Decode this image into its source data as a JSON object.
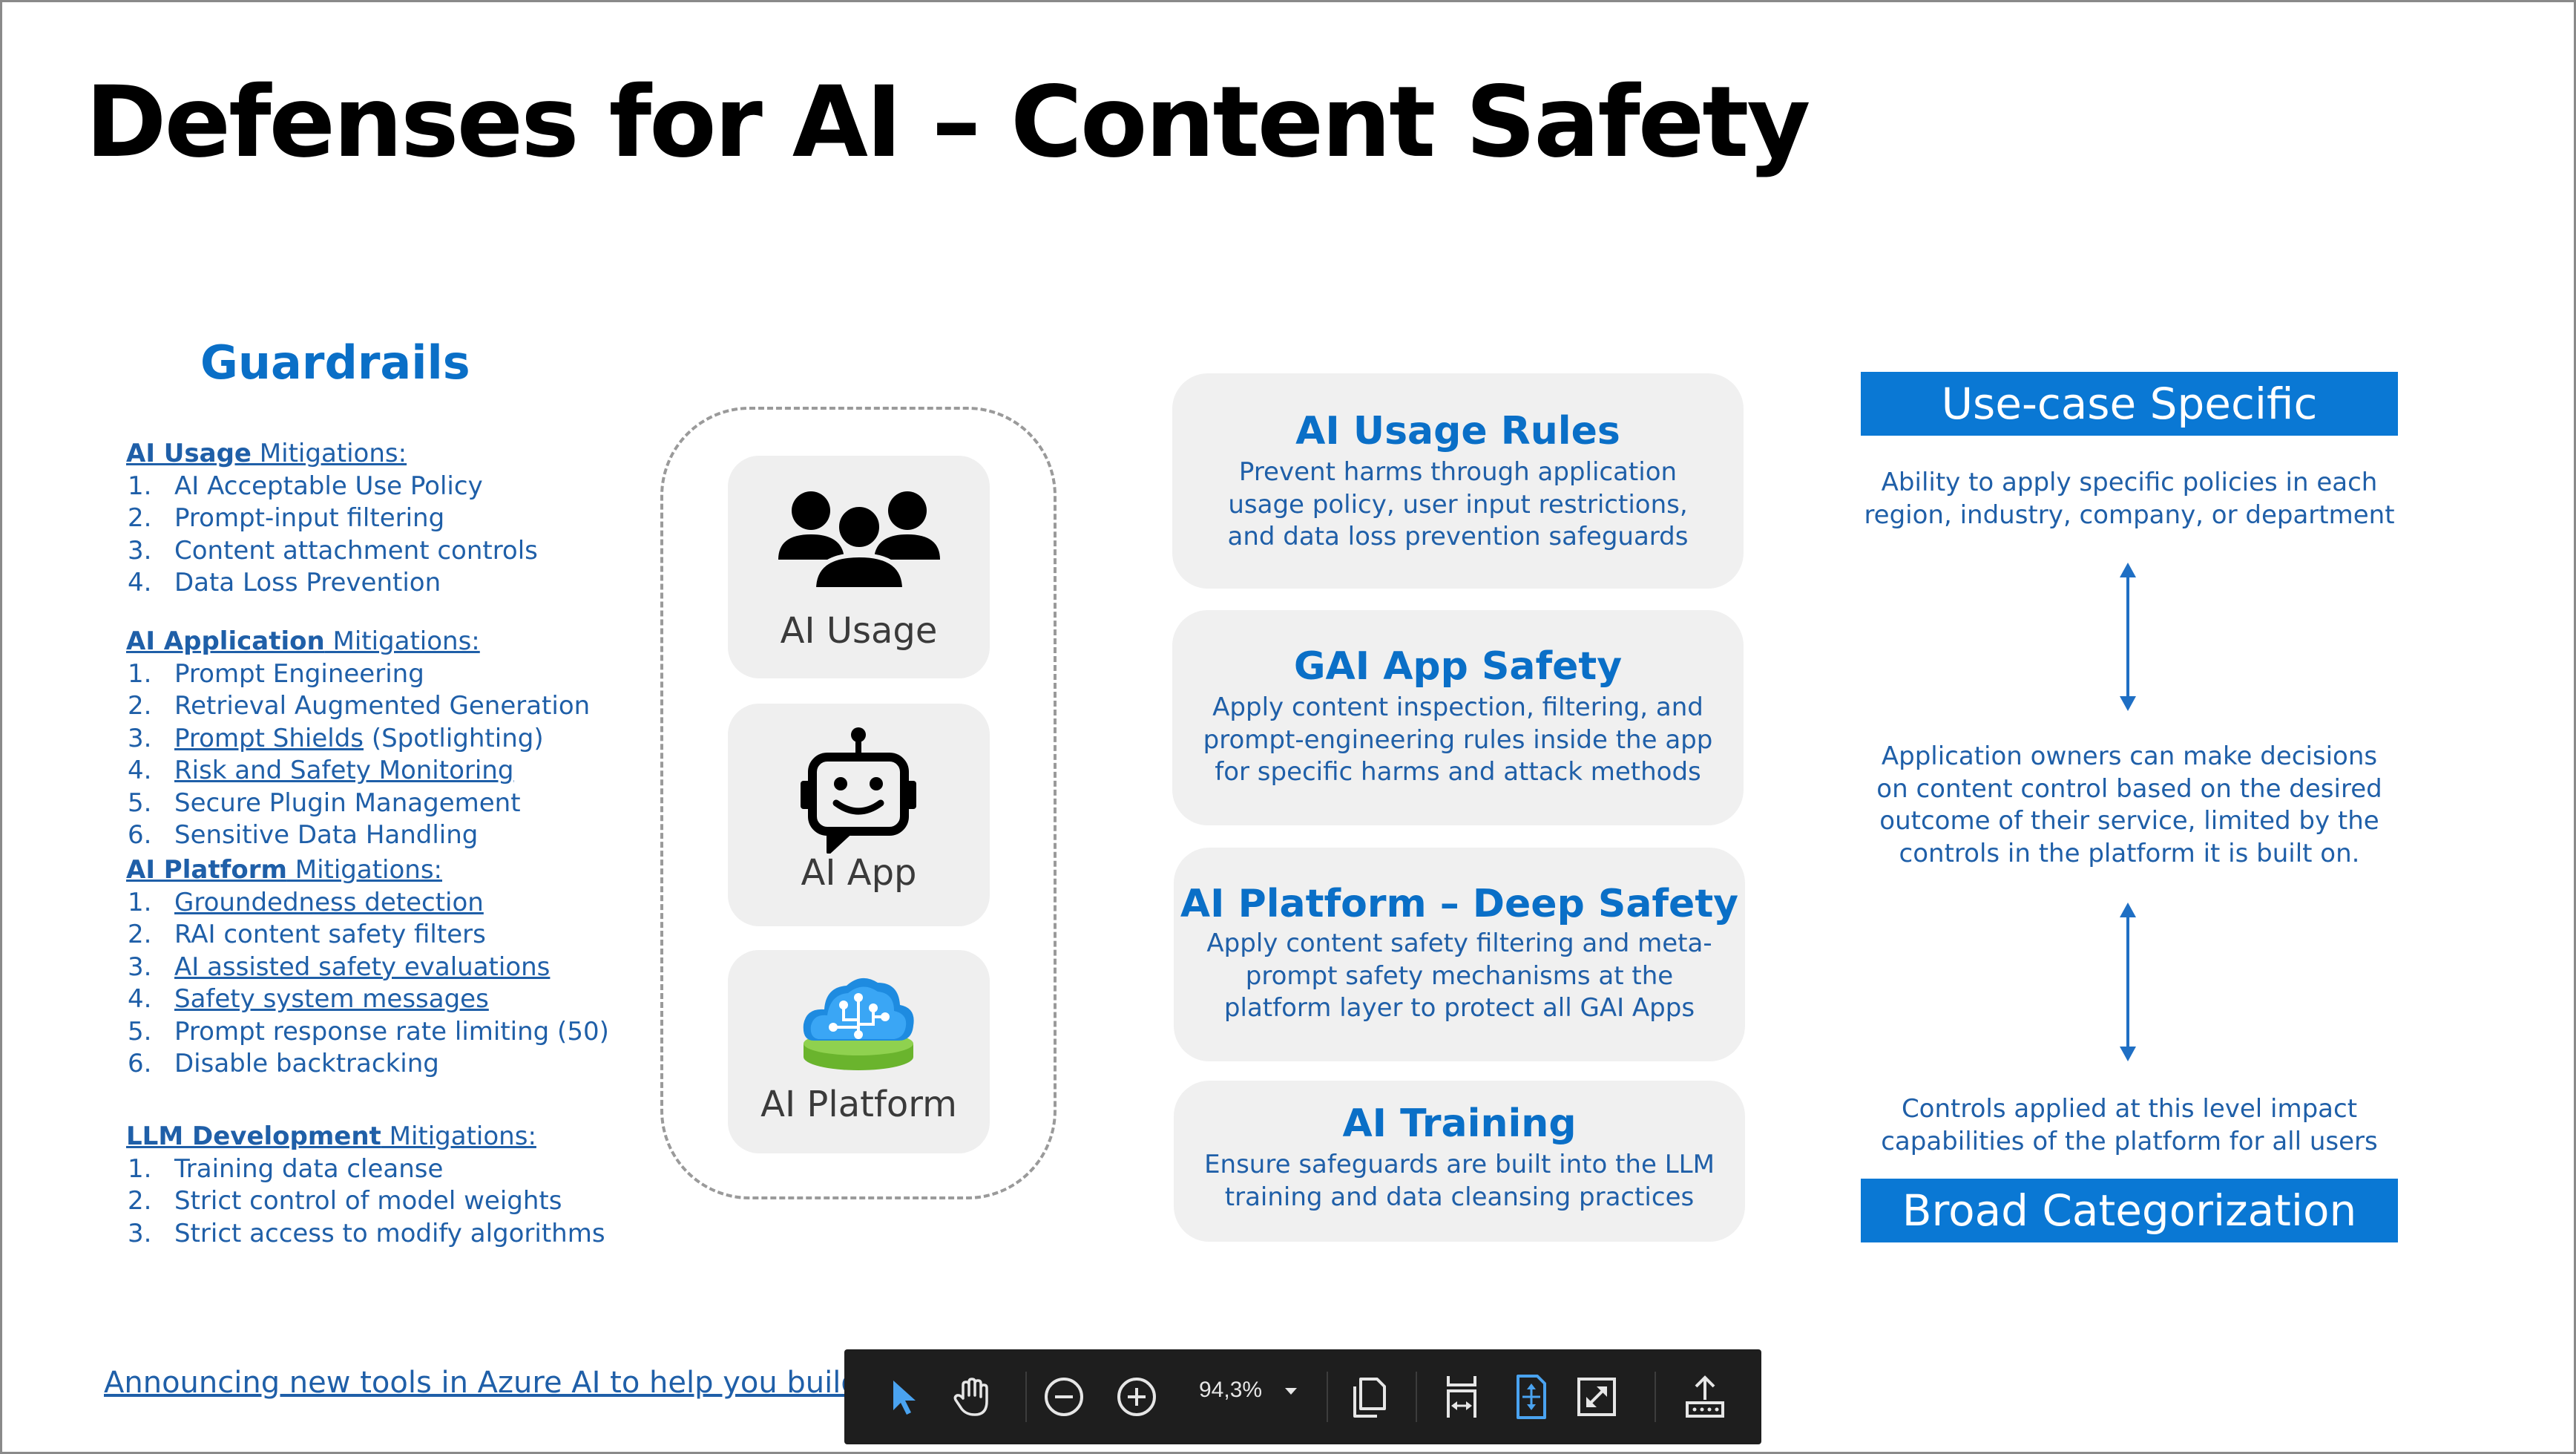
{
  "slide": {
    "title": "Defenses for AI – Content Safety",
    "guardrails_heading": "Guardrails"
  },
  "mitigations": [
    {
      "heading_link": "AI Usage",
      "heading_rest": " Mitigations:",
      "items": [
        {
          "num": "1.",
          "text": "AI Acceptable Use Policy",
          "link": false
        },
        {
          "num": "2.",
          "text": "Prompt-input filtering",
          "link": false
        },
        {
          "num": "3.",
          "text": "Content attachment controls",
          "link": false
        },
        {
          "num": "4.",
          "text": "Data Loss Prevention",
          "link": false
        }
      ]
    },
    {
      "heading_link": "AI Application",
      "heading_rest": " Mitigations:",
      "items": [
        {
          "num": "1.",
          "text": "Prompt Engineering",
          "link": false
        },
        {
          "num": "2.",
          "text": "Retrieval Augmented Generation",
          "link": false
        },
        {
          "num": "3.",
          "text": "Prompt Shields",
          "suffix": " (Spotlighting)",
          "link": true
        },
        {
          "num": "4.",
          "text": "Risk and Safety Monitoring",
          "link": true
        },
        {
          "num": "5.",
          "text": "Secure Plugin Management",
          "link": false
        },
        {
          "num": "6.",
          "text": "Sensitive Data Handling",
          "link": false
        }
      ]
    },
    {
      "heading_link": "AI Platform",
      "heading_rest": " Mitigations:",
      "items": [
        {
          "num": "1.",
          "text": "Groundedness detection",
          "link": true
        },
        {
          "num": "2.",
          "text": "RAI content safety filters",
          "link": false
        },
        {
          "num": "3.",
          "text": "AI assisted safety evaluations",
          "link": true
        },
        {
          "num": "4.",
          "text": "Safety system messages",
          "link": true
        },
        {
          "num": "5.",
          "text": "Prompt response rate limiting (50)",
          "link": false
        },
        {
          "num": "6.",
          "text": "Disable backtracking",
          "link": false
        }
      ]
    },
    {
      "heading_link": "LLM Development",
      "heading_rest": " Mitigations:",
      "items": [
        {
          "num": "1.",
          "text": "Training data cleanse",
          "link": false
        },
        {
          "num": "2.",
          "text": "Strict control of model weights",
          "link": false
        },
        {
          "num": "3.",
          "text": "Strict access to modify algorithms",
          "link": false
        }
      ]
    }
  ],
  "tiles": {
    "usage": "AI Usage",
    "app": "AI App",
    "platform": "AI Platform"
  },
  "cards": [
    {
      "title": "AI Usage Rules",
      "lines": [
        "Prevent harms through application",
        "usage policy, user input restrictions,",
        "and data loss prevention safeguards"
      ]
    },
    {
      "title": "GAI App Safety",
      "lines": [
        "Apply content inspection, filtering, and",
        "prompt-engineering rules inside the app",
        "for specific harms and attack methods"
      ]
    },
    {
      "title": "AI Platform – Deep Safety",
      "lines": [
        "Apply content safety filtering and meta-",
        "prompt safety mechanisms at the",
        "platform layer to protect all GAI Apps"
      ]
    },
    {
      "title": "AI Training",
      "lines": [
        "Ensure safeguards are built into the LLM",
        "training and data cleansing practices"
      ]
    }
  ],
  "right_panel": {
    "top_band": "Use-case Specific",
    "top_text": [
      "Ability to apply specific policies in each",
      "region, industry, company, or department"
    ],
    "middle_text": [
      "Application owners can make decisions",
      "on content control based on the desired",
      "outcome of their service, limited by the",
      "controls in the platform it is built on."
    ],
    "bottom_text": [
      "Controls applied at this level impact",
      "capabilities of the platform for all users"
    ],
    "bottom_band": "Broad Categorization"
  },
  "footer_link": "Announcing new tools in Azure AI to help you build more",
  "toolbar": {
    "zoom": "94,3%",
    "icons": [
      "select-pointer-icon",
      "hand-pan-icon",
      "zoom-out-icon",
      "zoom-in-icon",
      "zoom-dropdown-icon",
      "page-view-icon",
      "fit-width-icon",
      "fit-page-icon",
      "fullscreen-icon",
      "share-icon"
    ],
    "accent": "#4aa3f0"
  },
  "colors": {
    "title": "#000000",
    "accent_blue": "#0a6fc7",
    "text_blue": "#1f5fa8",
    "band_blue": "#0a78d4",
    "card_bg": "#f0f0f0",
    "toolbar_bg": "#1e1e1e"
  }
}
